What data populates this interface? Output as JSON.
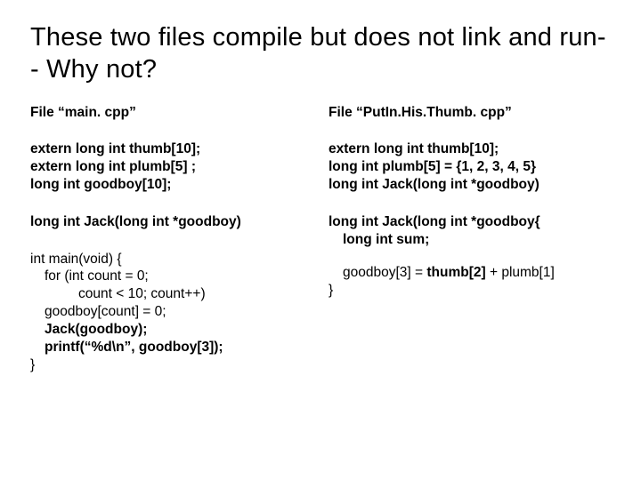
{
  "title": "These two files compile but does not link and run-- Why not?",
  "left": {
    "file_label": "File “main. cpp”",
    "decl1": "extern long int thumb[10];",
    "decl2": "extern long int plumb[5] ;",
    "decl3": "long int goodboy[10];",
    "proto": "long int Jack(long int *goodboy)",
    "main_sig": "int main(void) {",
    "for1": "for (int count = 0;",
    "for2": "count < 10; count++)",
    "body1": "goodboy[count] = 0;",
    "body2": "Jack(goodboy);",
    "body3": "printf(“%d\\n”, goodboy[3]);",
    "close": "}"
  },
  "right": {
    "file_label": "File “PutIn.His.Thumb. cpp”",
    "decl1": "extern long int thumb[10];",
    "decl2": "long int plumb[5] = {1, 2, 3, 4, 5}",
    "decl3": "long int Jack(long int *goodboy)",
    "func_sig": "long int Jack(long int *goodboy{",
    "body1": "long int sum;",
    "assign_a": "goodboy[3] = ",
    "assign_b": "thumb[2]",
    "assign_c": " + plumb[1]",
    "close": "}"
  }
}
